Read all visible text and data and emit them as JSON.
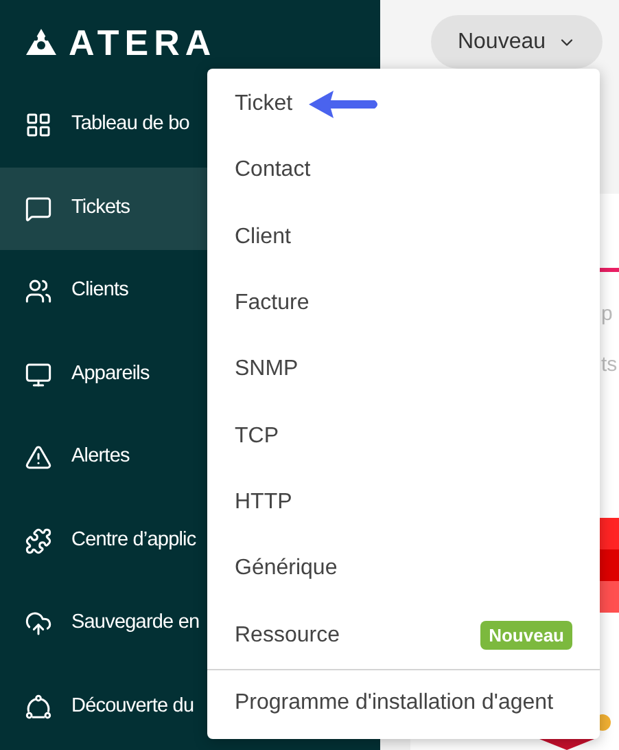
{
  "sidebar": {
    "logo": "ATERA",
    "items": [
      {
        "label": "Tableau de bo",
        "selected": false
      },
      {
        "label": "Tickets",
        "selected": true
      },
      {
        "label": "Clients",
        "selected": false
      },
      {
        "label": "Appareils",
        "selected": false
      },
      {
        "label": "Alertes",
        "selected": false
      },
      {
        "label": "Centre d’applic",
        "selected": false
      },
      {
        "label": "Sauvegarde en",
        "selected": false
      },
      {
        "label": "Découverte du",
        "selected": false
      }
    ]
  },
  "header": {
    "new_button": "Nouveau"
  },
  "background_fragments": [
    "p",
    "ts"
  ],
  "new_menu": {
    "items": [
      {
        "label": "Ticket",
        "pointed": true
      },
      {
        "label": "Contact",
        "pointed": false
      },
      {
        "label": "Client",
        "pointed": false
      },
      {
        "label": "Facture",
        "pointed": false
      },
      {
        "label": "SNMP",
        "pointed": false
      },
      {
        "label": "TCP",
        "pointed": false
      },
      {
        "label": "HTTP",
        "pointed": false
      },
      {
        "label": "Générique",
        "pointed": false
      },
      {
        "label": "Ressource",
        "pointed": false,
        "badge": "Nouveau"
      }
    ],
    "footer_items": [
      {
        "label": "Programme d'installation d'agent"
      }
    ]
  }
}
